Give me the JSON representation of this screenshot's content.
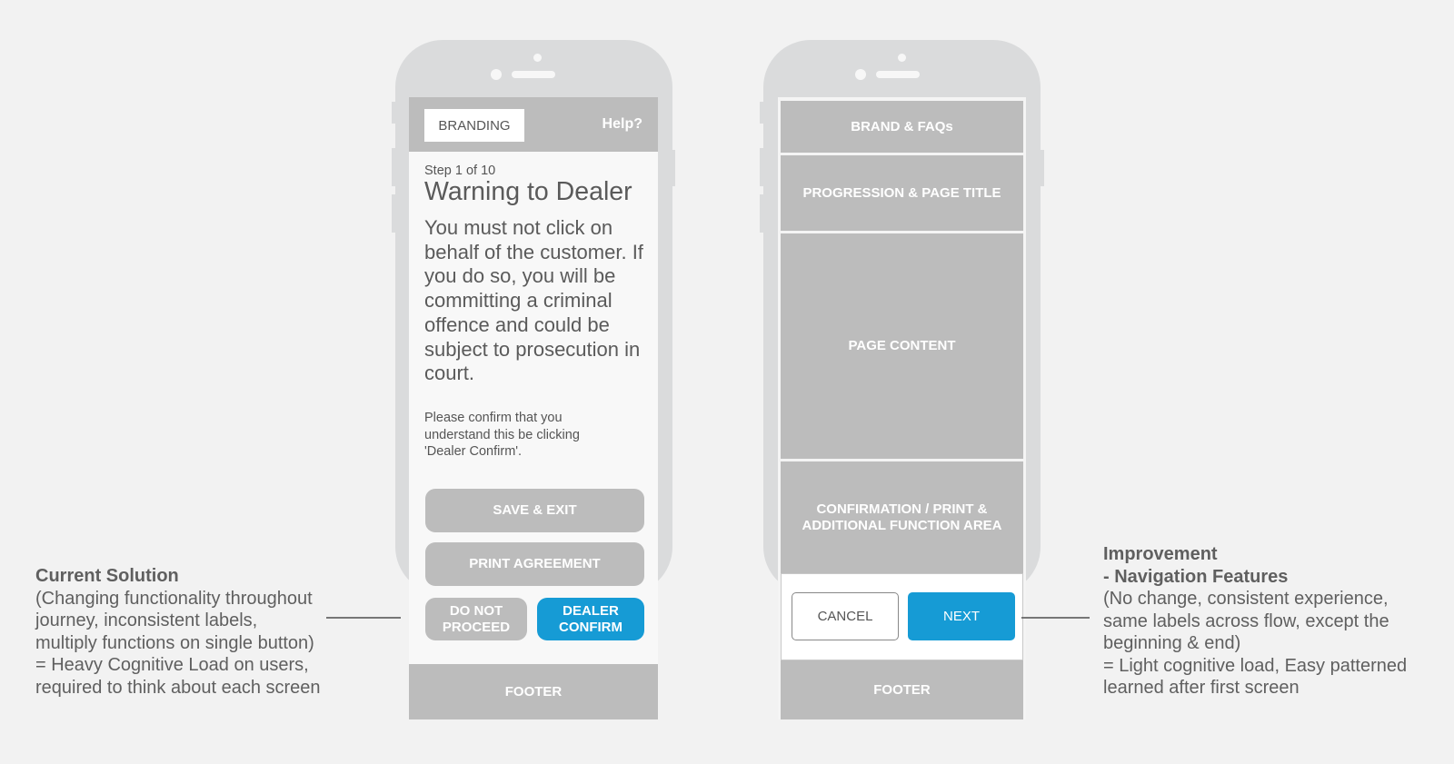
{
  "current": {
    "header": {
      "branding": "BRANDING",
      "help": "Help?"
    },
    "step": "Step 1 of 10",
    "title": "Warning to Dealer",
    "warning": "You must not click on behalf of the customer. If you do so, you will be committing a criminal offence and could be subject to prosecution in court.",
    "confirm_text": "Please confirm that you understand this be clicking 'Dealer Confirm'.",
    "buttons": {
      "save_exit": "SAVE & EXIT",
      "print": "PRINT AGREEMENT",
      "do_not_proceed": "DO NOT PROCEED",
      "dealer_confirm": "DEALER CONFIRM"
    },
    "footer": "FOOTER"
  },
  "improved": {
    "sections": {
      "brand": "BRAND & FAQs",
      "progression": "PROGRESSION & PAGE TITLE",
      "content": "PAGE CONTENT",
      "confirmation": "CONFIRMATION / PRINT & ADDITIONAL FUNCTION AREA"
    },
    "buttons": {
      "cancel": "CANCEL",
      "next": "NEXT"
    },
    "footer": "FOOTER"
  },
  "annotations": {
    "left": {
      "title": "Current Solution",
      "lines": [
        "(Changing functionality throughout",
        "journey, inconsistent labels,",
        "multiply functions on single button)",
        "= Heavy Cognitive Load on users,",
        "required to think about each screen"
      ]
    },
    "right": {
      "title": "Improvement",
      "subtitle": "- Navigation Features",
      "lines": [
        "(No change, consistent experience,",
        "same labels across flow, except the",
        "beginning & end)",
        "= Light cognitive load, Easy patterned",
        "learned after first screen"
      ]
    }
  },
  "colors": {
    "accent": "#169bd5",
    "block": "#bcbcbc",
    "phone": "#dadbdc",
    "background": "#f2f2f2"
  }
}
